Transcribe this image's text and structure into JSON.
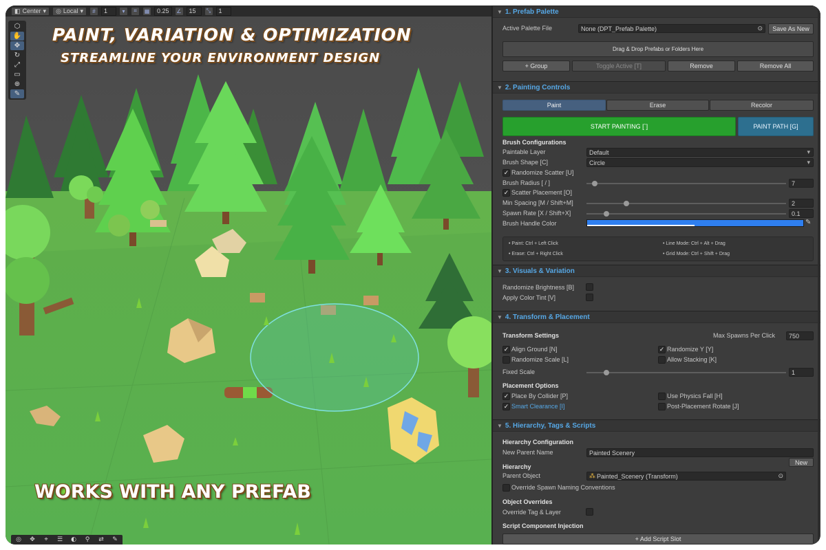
{
  "headlines": {
    "line1": "PAINT, VARIATION & OPTIMIZATION",
    "line2": "STREAMLINE YOUR ENVIRONMENT DESIGN",
    "line3": "WORKS WITH ANY PREFAB"
  },
  "scene_toolbar": {
    "pivot": "Center",
    "space": "Local",
    "grid_value": "1",
    "snap_value": "0.25",
    "angle_value": "15",
    "scale_value": "1"
  },
  "colors": {
    "accent_blue": "#56a8e6",
    "start_painting_green": "#27a02d",
    "paint_path_teal": "#2d6f8f",
    "brush_handle_color": "#2f7ff0",
    "selected_tab": "#46607f"
  },
  "tool_palette_icons": [
    "view-cube-icon",
    "hand-icon",
    "move-icon",
    "rotate-icon",
    "scale-icon",
    "rect-icon",
    "transform-icon",
    "custom-tool-icon"
  ],
  "bottom_toolbar_icons": [
    "compass-icon",
    "move-icon",
    "snap-icon",
    "layers-icon",
    "sphere-icon",
    "search-icon",
    "arrows-icon",
    "brush-icon"
  ],
  "section1": {
    "title": "1. Prefab Palette",
    "active_palette_label": "Active Palette File",
    "active_palette_value": "None (DPT_Prefab Palette)",
    "save_as_new": "Save As New",
    "drop_zone": "Drag & Drop Prefabs or Folders Here",
    "buttons": [
      "+ Group",
      "Toggle Active [T]",
      "Remove",
      "Remove All"
    ]
  },
  "section2": {
    "title": "2. Painting Controls",
    "tabs": [
      "Paint",
      "Erase",
      "Recolor"
    ],
    "start_painting": "START PAINTING [`]",
    "paint_path": "PAINT PATH [G]",
    "brush_config_title": "Brush Configurations",
    "paintable_layer_label": "Paintable Layer",
    "paintable_layer_value": "Default",
    "brush_shape_label": "Brush Shape [C]",
    "brush_shape_value": "Circle",
    "randomize_scatter": "Randomize Scatter [U]",
    "brush_radius_label": "Brush Radius [ / ]",
    "brush_radius_value": "7",
    "scatter_placement": "Scatter Placement [O]",
    "min_spacing_label": "Min Spacing [M / Shift+M]",
    "min_spacing_value": "2",
    "spawn_rate_label": "Spawn Rate [X / Shift+X]",
    "spawn_rate_value": "0.1",
    "brush_handle_label": "Brush Handle Color",
    "hints": [
      "• Paint: Ctrl + Left Click",
      "• Erase: Ctrl + Right Click",
      "• Line Mode: Ctrl + Alt + Drag",
      "• Grid Mode: Ctrl + Shift + Drag"
    ]
  },
  "section3": {
    "title": "3. Visuals & Variation",
    "randomize_brightness": "Randomize Brightness [B]",
    "apply_color_tint": "Apply Color Tint [V]"
  },
  "section4": {
    "title": "4. Transform & Placement",
    "transform_settings": "Transform Settings",
    "max_spawns_label": "Max Spawns Per Click",
    "max_spawns_value": "750",
    "align_ground": "Align Ground [N]",
    "randomize_y": "Randomize Y [Y]",
    "randomize_scale": "Randomize Scale [L]",
    "allow_stacking": "Allow Stacking [K]",
    "fixed_scale_label": "Fixed Scale",
    "fixed_scale_value": "1",
    "placement_options": "Placement Options",
    "place_by_collider": "Place By Collider [P]",
    "use_physics_fall": "Use Physics Fall [H]",
    "smart_clearance": "Smart Clearance [I]",
    "post_placement_rotate": "Post-Placement Rotate [J]"
  },
  "section5": {
    "title": "5. Hierarchy, Tags & Scripts",
    "hierarchy_config": "Hierarchy Configuration",
    "new_parent_label": "New Parent Name",
    "new_parent_value": "Painted Scenery",
    "new_button": "New",
    "hierarchy": "Hierarchy",
    "parent_object_label": "Parent Object",
    "parent_object_value": "Painted_Scenery (Transform)",
    "override_naming": "Override Spawn Naming Conventions",
    "object_overrides": "Object Overrides",
    "override_tag_layer": "Override Tag & Layer",
    "script_injection": "Script Component Injection",
    "add_script_slot": "+ Add Script Slot"
  },
  "checkmark": "✓"
}
